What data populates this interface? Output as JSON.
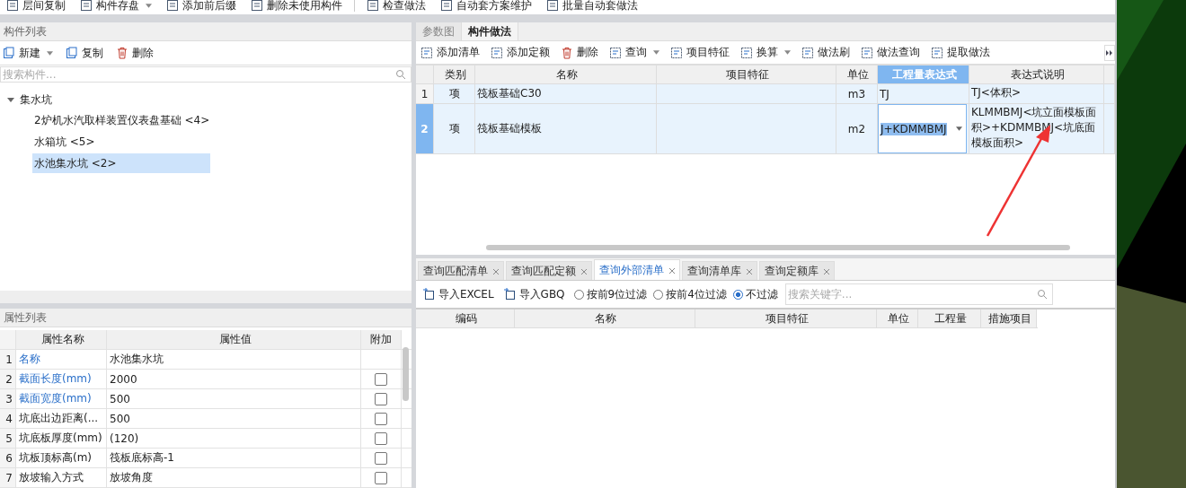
{
  "top_toolbar": [
    {
      "label": "层间复制",
      "dropdown": false
    },
    {
      "label": "构件存盘",
      "dropdown": true
    },
    {
      "label": "添加前后缀",
      "dropdown": false
    },
    {
      "label": "删除未使用构件",
      "dropdown": false
    },
    {
      "label": "检查做法",
      "dropdown": false
    },
    {
      "label": "自动套方案维护",
      "dropdown": false
    },
    {
      "label": "批量自动套做法",
      "dropdown": false
    }
  ],
  "component_list": {
    "title": "构件列表",
    "toolbar": [
      {
        "label": "新建",
        "dropdown": true
      },
      {
        "label": "复制",
        "dropdown": false
      },
      {
        "label": "删除",
        "dropdown": false
      }
    ],
    "search": {
      "placeholder": "搜索构件..."
    },
    "tree": [
      {
        "label": "集水坑",
        "expanded": true,
        "selected": false,
        "children": [
          {
            "label": "2炉机水汽取样装置仪表盘基础 <4>",
            "selected": false
          },
          {
            "label": "水箱坑 <5>",
            "selected": false
          },
          {
            "label": "水池集水坑 <2>",
            "selected": true
          }
        ]
      }
    ]
  },
  "property_list": {
    "title": "属性列表",
    "columns": [
      "属性名称",
      "属性值",
      "附加"
    ],
    "rows": [
      {
        "index": "1",
        "name": "名称",
        "value": "水池集水坑",
        "highlighted": true
      },
      {
        "index": "2",
        "name": "截面长度(mm)",
        "value": "2000",
        "highlighted": true,
        "checked": false
      },
      {
        "index": "3",
        "name": "截面宽度(mm)",
        "value": "500",
        "highlighted": true,
        "checked": false
      },
      {
        "index": "4",
        "name": "坑底出边距离(...",
        "value": "500",
        "highlighted": false,
        "checked": false
      },
      {
        "index": "5",
        "name": "坑底板厚度(mm)",
        "value": "(120)",
        "highlighted": false,
        "checked": false
      },
      {
        "index": "6",
        "name": "坑板顶标高(m)",
        "value": "筏板底标高-1",
        "highlighted": false,
        "checked": false
      },
      {
        "index": "7",
        "name": "放坡输入方式",
        "value": "放坡角度",
        "highlighted": false,
        "checked": false
      }
    ]
  },
  "method_panel": {
    "tabs": [
      {
        "label": "参数图",
        "selected": false
      },
      {
        "label": "构件做法",
        "selected": true
      }
    ],
    "toolbar": [
      {
        "label": "添加清单",
        "dropdown": false
      },
      {
        "label": "添加定额",
        "dropdown": false
      },
      {
        "label": "删除",
        "dropdown": false
      },
      {
        "label": "查询",
        "dropdown": true
      },
      {
        "label": "项目特征",
        "dropdown": false
      },
      {
        "label": "换算",
        "dropdown": true
      },
      {
        "label": "做法刷",
        "dropdown": false
      },
      {
        "label": "做法查询",
        "dropdown": false
      },
      {
        "label": "提取做法",
        "dropdown": false
      }
    ],
    "columns": [
      {
        "label": "类别",
        "selected": false
      },
      {
        "label": "名称",
        "selected": false
      },
      {
        "label": "项目特征",
        "selected": false
      },
      {
        "label": "单位",
        "selected": false
      },
      {
        "label": "工程量表达式",
        "selected": true
      },
      {
        "label": "表达式说明",
        "selected": false
      }
    ],
    "rows": [
      {
        "index": "1",
        "selected": false,
        "category": "项",
        "name": "筏板基础C30",
        "feature": "",
        "unit": "m3",
        "expression": "TJ",
        "editing": false,
        "description": "TJ<体积>"
      },
      {
        "index": "2",
        "selected": true,
        "category": "项",
        "name": "筏板基础模板",
        "feature": "",
        "unit": "m2",
        "expression": "J+KDMMBMJ",
        "editing": true,
        "description": "KLMMBMJ<坑立面模板面积>+KDMMBMJ<坑底面模板面积>"
      }
    ]
  },
  "query_panel": {
    "tabs": [
      {
        "label": "查询匹配清单",
        "selected": false
      },
      {
        "label": "查询匹配定额",
        "selected": false
      },
      {
        "label": "查询外部清单",
        "selected": true
      },
      {
        "label": "查询清单库",
        "selected": false
      },
      {
        "label": "查询定额库",
        "selected": false
      }
    ],
    "buttons": [
      "导入EXCEL",
      "导入GBQ"
    ],
    "filters": [
      {
        "label": "按前9位过滤",
        "selected": false
      },
      {
        "label": "按前4位过滤",
        "selected": false
      },
      {
        "label": "不过滤",
        "selected": true
      }
    ],
    "search": {
      "placeholder": "搜索关键字..."
    },
    "columns": [
      "编码",
      "名称",
      "项目特征",
      "单位",
      "工程量",
      "措施项目"
    ]
  }
}
